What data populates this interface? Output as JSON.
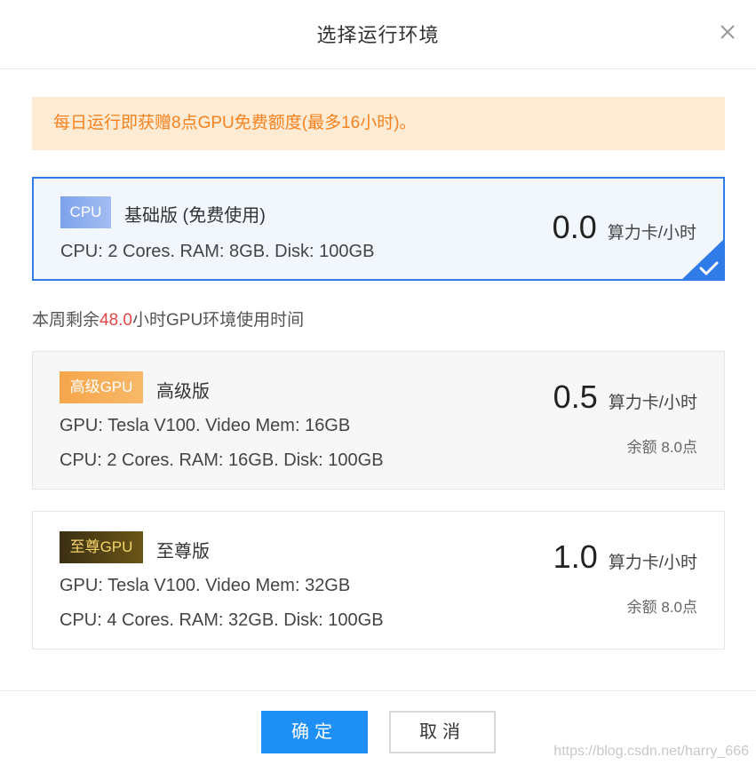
{
  "dialog": {
    "title": "选择运行环境",
    "close_icon": "close-icon"
  },
  "notice": {
    "text": "每日运行即获赠8点GPU免费额度(最多16小时)。",
    "color": "#f5821f",
    "background": "#fdebd3"
  },
  "options": [
    {
      "badge": "CPU",
      "edition": "基础版 (免费使用)",
      "specs": [
        "CPU: 2 Cores. RAM: 8GB. Disk: 100GB"
      ],
      "price": "0.0",
      "unit": "算力卡/小时",
      "selected": true,
      "selected_icon": "checkmark-icon"
    },
    {
      "badge": "高级GPU",
      "edition": "高级版",
      "specs": [
        "GPU: Tesla V100. Video Mem: 16GB",
        "CPU: 2 Cores. RAM: 16GB. Disk: 100GB"
      ],
      "price": "0.5",
      "unit": "算力卡/小时",
      "balance": "余额 8.0点",
      "selected": false
    },
    {
      "badge": "至尊GPU",
      "edition": "至尊版",
      "specs": [
        "GPU: Tesla V100. Video Mem: 32GB",
        "CPU: 4 Cores. RAM: 32GB. Disk: 100GB"
      ],
      "price": "1.0",
      "unit": "算力卡/小时",
      "balance": "余额 8.0点",
      "selected": false
    }
  ],
  "remaining": {
    "prefix": "本周剩余",
    "hours": "48.0",
    "suffix": "小时GPU环境使用时间",
    "highlight_color": "#e64545"
  },
  "buttons": {
    "confirm": "确定",
    "cancel": "取消"
  },
  "watermark": "https://blog.csdn.net/harry_666",
  "colors": {
    "accent": "#1d8ff5",
    "selected_border": "#2f7ce8"
  }
}
